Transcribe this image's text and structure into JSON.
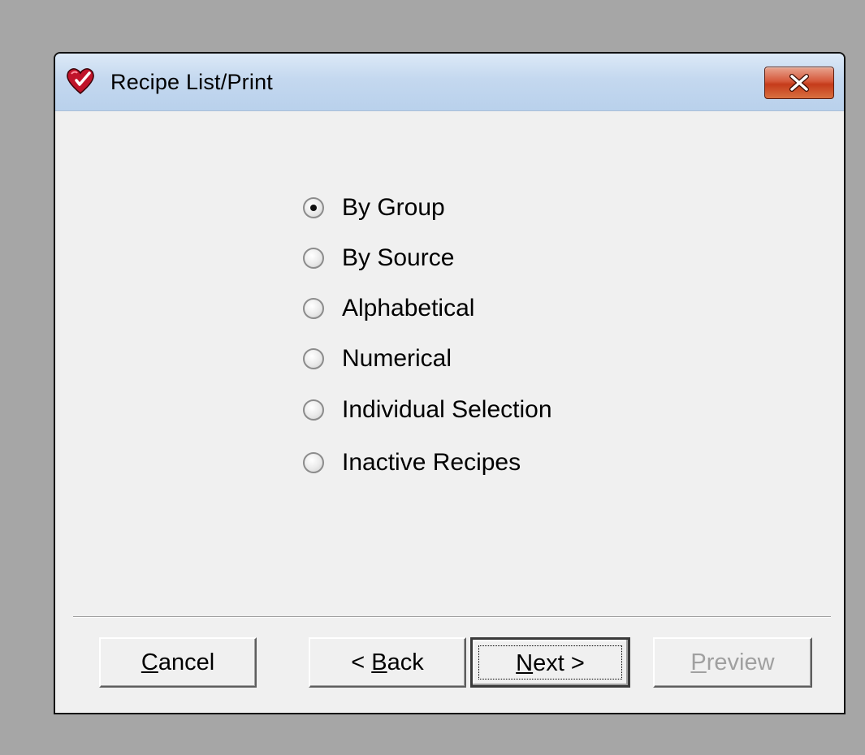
{
  "window": {
    "title": "Recipe List/Print",
    "icon": "heart-icon",
    "close_icon": "close-icon"
  },
  "options": [
    {
      "label": "By Group",
      "selected": true
    },
    {
      "label": "By Source",
      "selected": false
    },
    {
      "label": "Alphabetical",
      "selected": false
    },
    {
      "label": "Numerical",
      "selected": false
    },
    {
      "label": "Individual Selection",
      "selected": false
    },
    {
      "label": "Inactive Recipes",
      "selected": false
    }
  ],
  "buttons": {
    "cancel": {
      "accel": "C",
      "rest": "ancel",
      "enabled": true
    },
    "back": {
      "prefix": "< ",
      "accel": "B",
      "rest": "ack",
      "enabled": true
    },
    "next": {
      "accel": "N",
      "rest": "ext >",
      "enabled": true,
      "default": true
    },
    "preview": {
      "accel": "P",
      "rest": "review",
      "enabled": false
    }
  },
  "colors": {
    "desktop": "#a6a6a6",
    "dialog_face": "#f0f0f0",
    "close_button": "#c53b1b",
    "disabled_text": "#a0a0a0"
  }
}
